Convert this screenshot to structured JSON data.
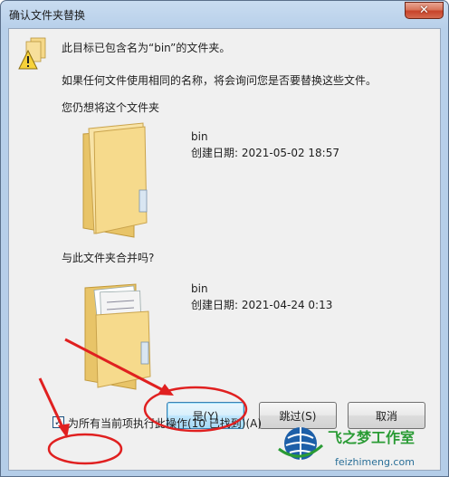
{
  "window": {
    "title": "确认文件夹替换",
    "close_label": "✕"
  },
  "message": {
    "line1": "此目标已包含名为“bin”的文件夹。",
    "line2": "如果任何文件使用相同的名称，将会询问您是否要替换这些文件。",
    "line3": "您仍想将这个文件夹"
  },
  "target_folder": {
    "name": "bin",
    "created": "创建日期: 2021-05-02 18:57"
  },
  "merge_prompt": "与此文件夹合并吗?",
  "source_folder": {
    "name": "bin",
    "created": "创建日期: 2021-04-24 0:13"
  },
  "buttons": {
    "yes": "是(Y)",
    "skip": "跳过(S)",
    "cancel": "取消"
  },
  "apply_all": {
    "checked": true,
    "label": "为所有当前项执行此操作(10 已找到)(A)"
  },
  "watermark": {
    "brand": "飞之梦工作室",
    "url": "feizhimeng.com"
  },
  "colors": {
    "annotation_red": "#e02020",
    "folder_yellow": "#f3d27a",
    "watermark_green": "#2a9b35"
  }
}
